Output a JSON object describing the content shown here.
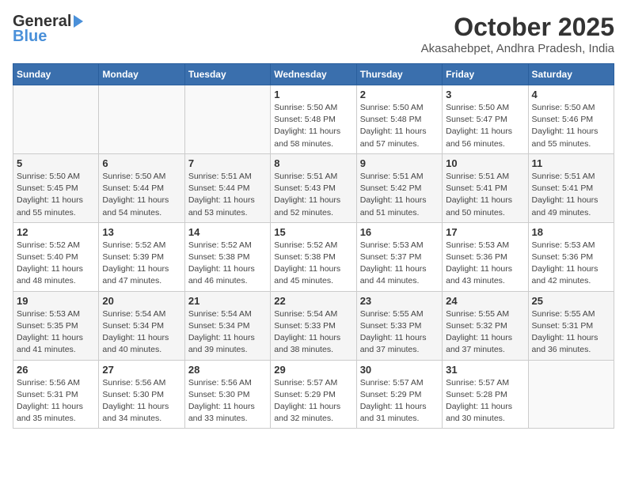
{
  "header": {
    "logo_general": "General",
    "logo_blue": "Blue",
    "month_title": "October 2025",
    "location": "Akasahebpet, Andhra Pradesh, India"
  },
  "days_of_week": [
    "Sunday",
    "Monday",
    "Tuesday",
    "Wednesday",
    "Thursday",
    "Friday",
    "Saturday"
  ],
  "weeks": [
    [
      {
        "day": "",
        "info": ""
      },
      {
        "day": "",
        "info": ""
      },
      {
        "day": "",
        "info": ""
      },
      {
        "day": "1",
        "info": "Sunrise: 5:50 AM\nSunset: 5:48 PM\nDaylight: 11 hours and 58 minutes."
      },
      {
        "day": "2",
        "info": "Sunrise: 5:50 AM\nSunset: 5:48 PM\nDaylight: 11 hours and 57 minutes."
      },
      {
        "day": "3",
        "info": "Sunrise: 5:50 AM\nSunset: 5:47 PM\nDaylight: 11 hours and 56 minutes."
      },
      {
        "day": "4",
        "info": "Sunrise: 5:50 AM\nSunset: 5:46 PM\nDaylight: 11 hours and 55 minutes."
      }
    ],
    [
      {
        "day": "5",
        "info": "Sunrise: 5:50 AM\nSunset: 5:45 PM\nDaylight: 11 hours and 55 minutes."
      },
      {
        "day": "6",
        "info": "Sunrise: 5:50 AM\nSunset: 5:44 PM\nDaylight: 11 hours and 54 minutes."
      },
      {
        "day": "7",
        "info": "Sunrise: 5:51 AM\nSunset: 5:44 PM\nDaylight: 11 hours and 53 minutes."
      },
      {
        "day": "8",
        "info": "Sunrise: 5:51 AM\nSunset: 5:43 PM\nDaylight: 11 hours and 52 minutes."
      },
      {
        "day": "9",
        "info": "Sunrise: 5:51 AM\nSunset: 5:42 PM\nDaylight: 11 hours and 51 minutes."
      },
      {
        "day": "10",
        "info": "Sunrise: 5:51 AM\nSunset: 5:41 PM\nDaylight: 11 hours and 50 minutes."
      },
      {
        "day": "11",
        "info": "Sunrise: 5:51 AM\nSunset: 5:41 PM\nDaylight: 11 hours and 49 minutes."
      }
    ],
    [
      {
        "day": "12",
        "info": "Sunrise: 5:52 AM\nSunset: 5:40 PM\nDaylight: 11 hours and 48 minutes."
      },
      {
        "day": "13",
        "info": "Sunrise: 5:52 AM\nSunset: 5:39 PM\nDaylight: 11 hours and 47 minutes."
      },
      {
        "day": "14",
        "info": "Sunrise: 5:52 AM\nSunset: 5:38 PM\nDaylight: 11 hours and 46 minutes."
      },
      {
        "day": "15",
        "info": "Sunrise: 5:52 AM\nSunset: 5:38 PM\nDaylight: 11 hours and 45 minutes."
      },
      {
        "day": "16",
        "info": "Sunrise: 5:53 AM\nSunset: 5:37 PM\nDaylight: 11 hours and 44 minutes."
      },
      {
        "day": "17",
        "info": "Sunrise: 5:53 AM\nSunset: 5:36 PM\nDaylight: 11 hours and 43 minutes."
      },
      {
        "day": "18",
        "info": "Sunrise: 5:53 AM\nSunset: 5:36 PM\nDaylight: 11 hours and 42 minutes."
      }
    ],
    [
      {
        "day": "19",
        "info": "Sunrise: 5:53 AM\nSunset: 5:35 PM\nDaylight: 11 hours and 41 minutes."
      },
      {
        "day": "20",
        "info": "Sunrise: 5:54 AM\nSunset: 5:34 PM\nDaylight: 11 hours and 40 minutes."
      },
      {
        "day": "21",
        "info": "Sunrise: 5:54 AM\nSunset: 5:34 PM\nDaylight: 11 hours and 39 minutes."
      },
      {
        "day": "22",
        "info": "Sunrise: 5:54 AM\nSunset: 5:33 PM\nDaylight: 11 hours and 38 minutes."
      },
      {
        "day": "23",
        "info": "Sunrise: 5:55 AM\nSunset: 5:33 PM\nDaylight: 11 hours and 37 minutes."
      },
      {
        "day": "24",
        "info": "Sunrise: 5:55 AM\nSunset: 5:32 PM\nDaylight: 11 hours and 37 minutes."
      },
      {
        "day": "25",
        "info": "Sunrise: 5:55 AM\nSunset: 5:31 PM\nDaylight: 11 hours and 36 minutes."
      }
    ],
    [
      {
        "day": "26",
        "info": "Sunrise: 5:56 AM\nSunset: 5:31 PM\nDaylight: 11 hours and 35 minutes."
      },
      {
        "day": "27",
        "info": "Sunrise: 5:56 AM\nSunset: 5:30 PM\nDaylight: 11 hours and 34 minutes."
      },
      {
        "day": "28",
        "info": "Sunrise: 5:56 AM\nSunset: 5:30 PM\nDaylight: 11 hours and 33 minutes."
      },
      {
        "day": "29",
        "info": "Sunrise: 5:57 AM\nSunset: 5:29 PM\nDaylight: 11 hours and 32 minutes."
      },
      {
        "day": "30",
        "info": "Sunrise: 5:57 AM\nSunset: 5:29 PM\nDaylight: 11 hours and 31 minutes."
      },
      {
        "day": "31",
        "info": "Sunrise: 5:57 AM\nSunset: 5:28 PM\nDaylight: 11 hours and 30 minutes."
      },
      {
        "day": "",
        "info": ""
      }
    ]
  ]
}
